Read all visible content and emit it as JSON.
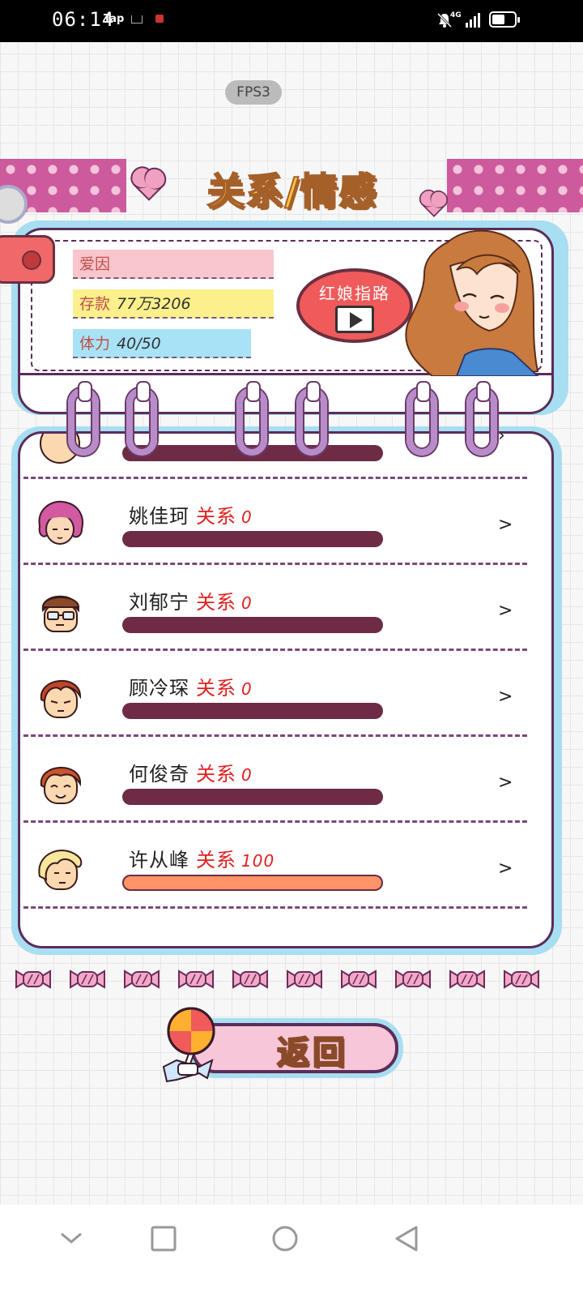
{
  "status_bar": {
    "time": "06:14",
    "app_label": "Tap",
    "network": "4G",
    "battery_level": 0.7
  },
  "fps": "FPS3",
  "title": "关系/情感",
  "player": {
    "name": "爱因",
    "savings_label": "存款",
    "savings_value": "77万3206",
    "stamina_label": "体力",
    "stamina_value": "40/50"
  },
  "guide_button": "红娘指路",
  "relationships": [
    {
      "name": "姚佳珂",
      "label": "关系",
      "value": "0",
      "level": 0,
      "face_icon": "pink-hair-girl-icon"
    },
    {
      "name": "刘郁宁",
      "label": "关系",
      "value": "0",
      "level": 0,
      "face_icon": "glasses-boy-icon"
    },
    {
      "name": "顾冷琛",
      "label": "关系",
      "value": "0",
      "level": 0,
      "face_icon": "red-hair-boy-icon"
    },
    {
      "name": "何俊奇",
      "label": "关系",
      "value": "0",
      "level": 0,
      "face_icon": "smiling-boy-icon"
    },
    {
      "name": "许从峰",
      "label": "关系",
      "value": "100",
      "level": 1,
      "face_icon": "blonde-boy-icon"
    }
  ],
  "chevron": ">",
  "return_button": "返回",
  "colors": {
    "accent_pink": "#cc5a9c",
    "title_yellow": "#ffc53d",
    "bar_empty": "#6e2b45",
    "bar_fill": "#ff9466",
    "frame_blue": "#a7def1"
  }
}
